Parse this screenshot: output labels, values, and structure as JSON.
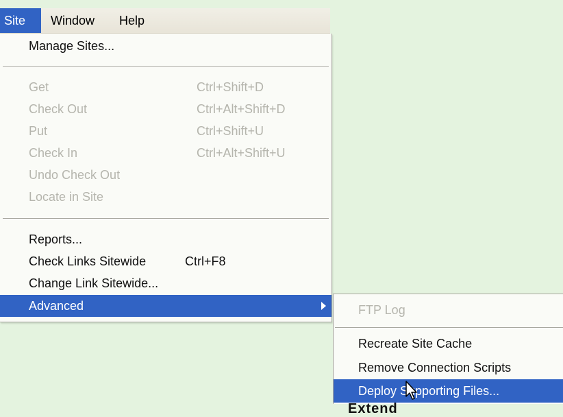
{
  "menubar": {
    "items": [
      {
        "label": "Site"
      },
      {
        "label": "Window"
      },
      {
        "label": "Help"
      }
    ]
  },
  "site_menu": {
    "manage_sites": "Manage Sites...",
    "get": {
      "label": "Get",
      "shortcut": "Ctrl+Shift+D"
    },
    "check_out": {
      "label": "Check Out",
      "shortcut": "Ctrl+Alt+Shift+D"
    },
    "put": {
      "label": "Put",
      "shortcut": "Ctrl+Shift+U"
    },
    "check_in": {
      "label": "Check In",
      "shortcut": "Ctrl+Alt+Shift+U"
    },
    "undo_check_out": "Undo Check Out",
    "locate_in_site": "Locate in Site",
    "reports": "Reports...",
    "check_links_sitewide": {
      "label": "Check Links Sitewide",
      "shortcut": "Ctrl+F8"
    },
    "change_link_sitewide": "Change Link Sitewide...",
    "advanced": "Advanced"
  },
  "advanced_submenu": {
    "ftp_log": "FTP Log",
    "recreate_site_cache": "Recreate Site Cache",
    "remove_connection_scripts": "Remove Connection Scripts",
    "deploy_supporting_files": "Deploy Supporting Files..."
  },
  "background_text": "Extend",
  "colors": {
    "selection": "#3163c4",
    "disabled_text": "#b5b5ad",
    "menu_bg": "#fafbf7",
    "page_bg": "#e4f3df"
  }
}
